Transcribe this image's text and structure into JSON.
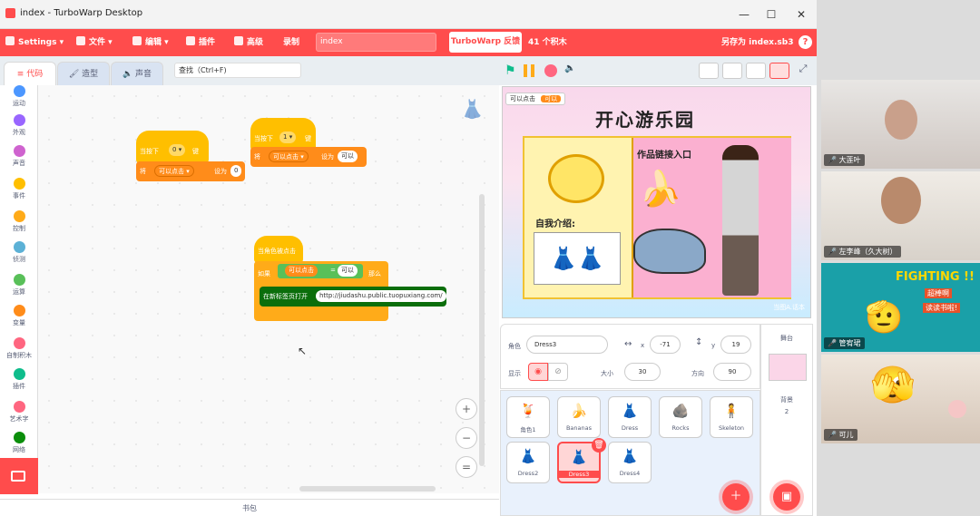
{
  "window": {
    "title": "index - TurboWarp Desktop",
    "controls": [
      "—",
      "☐",
      "✕"
    ]
  },
  "menu": {
    "settings": "Settings",
    "file": "文件",
    "edit": "编辑",
    "addons": "插件",
    "advanced": "高级",
    "record": "录制",
    "project_name": "index",
    "feedback": "TurboWarp 反馈",
    "block_count": "41 个积木",
    "save_as": "另存为 index.sb3",
    "help": "?"
  },
  "tabs": {
    "code": "代码",
    "costumes": "造型",
    "sounds": "声音"
  },
  "search": {
    "placeholder": "查找（Ctrl+F)"
  },
  "categories": [
    {
      "label": "运动",
      "color": "#4c97ff"
    },
    {
      "label": "外观",
      "color": "#9966ff"
    },
    {
      "label": "声音",
      "color": "#cf63cf"
    },
    {
      "label": "事件",
      "color": "#ffbf00"
    },
    {
      "label": "控制",
      "color": "#ffab19"
    },
    {
      "label": "侦测",
      "color": "#5cb1d6"
    },
    {
      "label": "运算",
      "color": "#59c059"
    },
    {
      "label": "变量",
      "color": "#ff8c1a"
    },
    {
      "label": "自制积木",
      "color": "#ff6680"
    },
    {
      "label": "插件",
      "color": "#0fbd8c"
    },
    {
      "label": "艺术字",
      "color": "#ff6680"
    },
    {
      "label": "网络",
      "color": "#0b8e0b"
    }
  ],
  "blocks": {
    "s1_hat": "当按下",
    "s1_key": "0",
    "s1_keysuffix": "键",
    "s1_set": "将",
    "s1_var": "可以点击",
    "s1_to": "设为",
    "s1_val": "0",
    "s2_hat": "当按下",
    "s2_key": "1",
    "s2_keysuffix": "键",
    "s2_set": "将",
    "s2_var": "可以点击",
    "s2_to": "设为",
    "s2_val": "可以",
    "s3_hat": "当角色被点击",
    "s3_if": "如果",
    "s3_var": "可以点击",
    "s3_eq": "=",
    "s3_val": "可以",
    "s3_then": "那么",
    "s3_open": "在新标签页打开",
    "s3_url": "http://jiudashu.public.tuopuxiang.com/"
  },
  "zoom": {
    "in": "+",
    "out": "−",
    "reset": "="
  },
  "backpack": "书包",
  "stage": {
    "monitor_label": "可以点击",
    "monitor_value": "可以",
    "title": "开心游乐园",
    "link_label": "作品链接入口",
    "intro_label": "自我介绍:",
    "watermark": "当图A.话本"
  },
  "sprite_info": {
    "sprite_label": "角色",
    "sprite_name": "Dress3",
    "x_label": "x",
    "x": "-71",
    "y_label": "y",
    "y": "19",
    "show_label": "显示",
    "size_label": "大小",
    "size": "30",
    "dir_label": "方向",
    "direction": "90"
  },
  "sprites": [
    {
      "name": "角色1",
      "icon": "🍹"
    },
    {
      "name": "Bananas",
      "icon": "🍌"
    },
    {
      "name": "Dress",
      "icon": "👗"
    },
    {
      "name": "Rocks",
      "icon": "🪨"
    },
    {
      "name": "Skeleton",
      "icon": "🧍"
    },
    {
      "name": "Dress2",
      "icon": "👗"
    },
    {
      "name": "Dress3",
      "icon": "👗"
    },
    {
      "name": "Dress4",
      "icon": "👗"
    }
  ],
  "stage_panel": {
    "title": "舞台",
    "backdrops_label": "背景",
    "backdrops_count": "2"
  },
  "video": [
    {
      "name": "大莲叶"
    },
    {
      "name": "左李峰（久大树）"
    },
    {
      "name": "管宥珺",
      "banner": "FIGHTING !!",
      "sub1": "超棒啊",
      "sub2": "读读书啦!"
    },
    {
      "name": "可儿"
    }
  ]
}
